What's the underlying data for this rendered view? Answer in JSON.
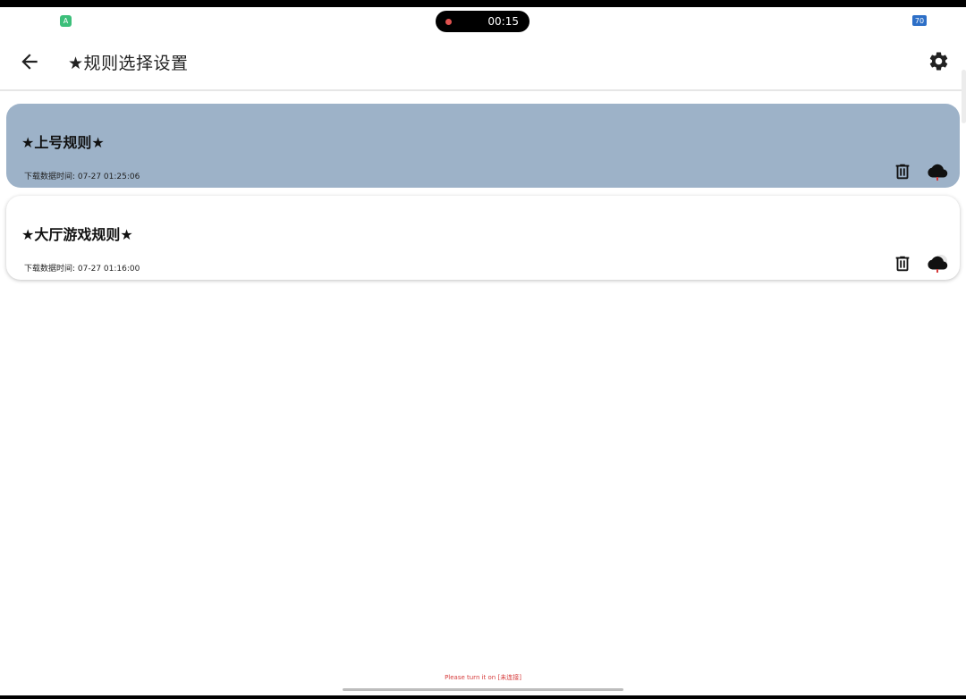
{
  "status_bar": {
    "left_icon": "android-notification-icon",
    "recording_time": "00:15",
    "battery": "70"
  },
  "app_bar": {
    "title": "★规则选择设置",
    "back_icon": "arrow-left-icon",
    "settings_icon": "gear-icon"
  },
  "rules": [
    {
      "title": "★上号规则★",
      "time_label": "下载数据时间: 07-27 01:25:06",
      "selected": true
    },
    {
      "title": "★大厅游戏规则★",
      "time_label": "下载数据时间: 07-27 01:16:00",
      "selected": false
    }
  ],
  "footer": {
    "note": "Please turn it on [未连接]"
  },
  "colors": {
    "selected_card": "#9db2c8",
    "accent_red": "#d63b3b"
  }
}
